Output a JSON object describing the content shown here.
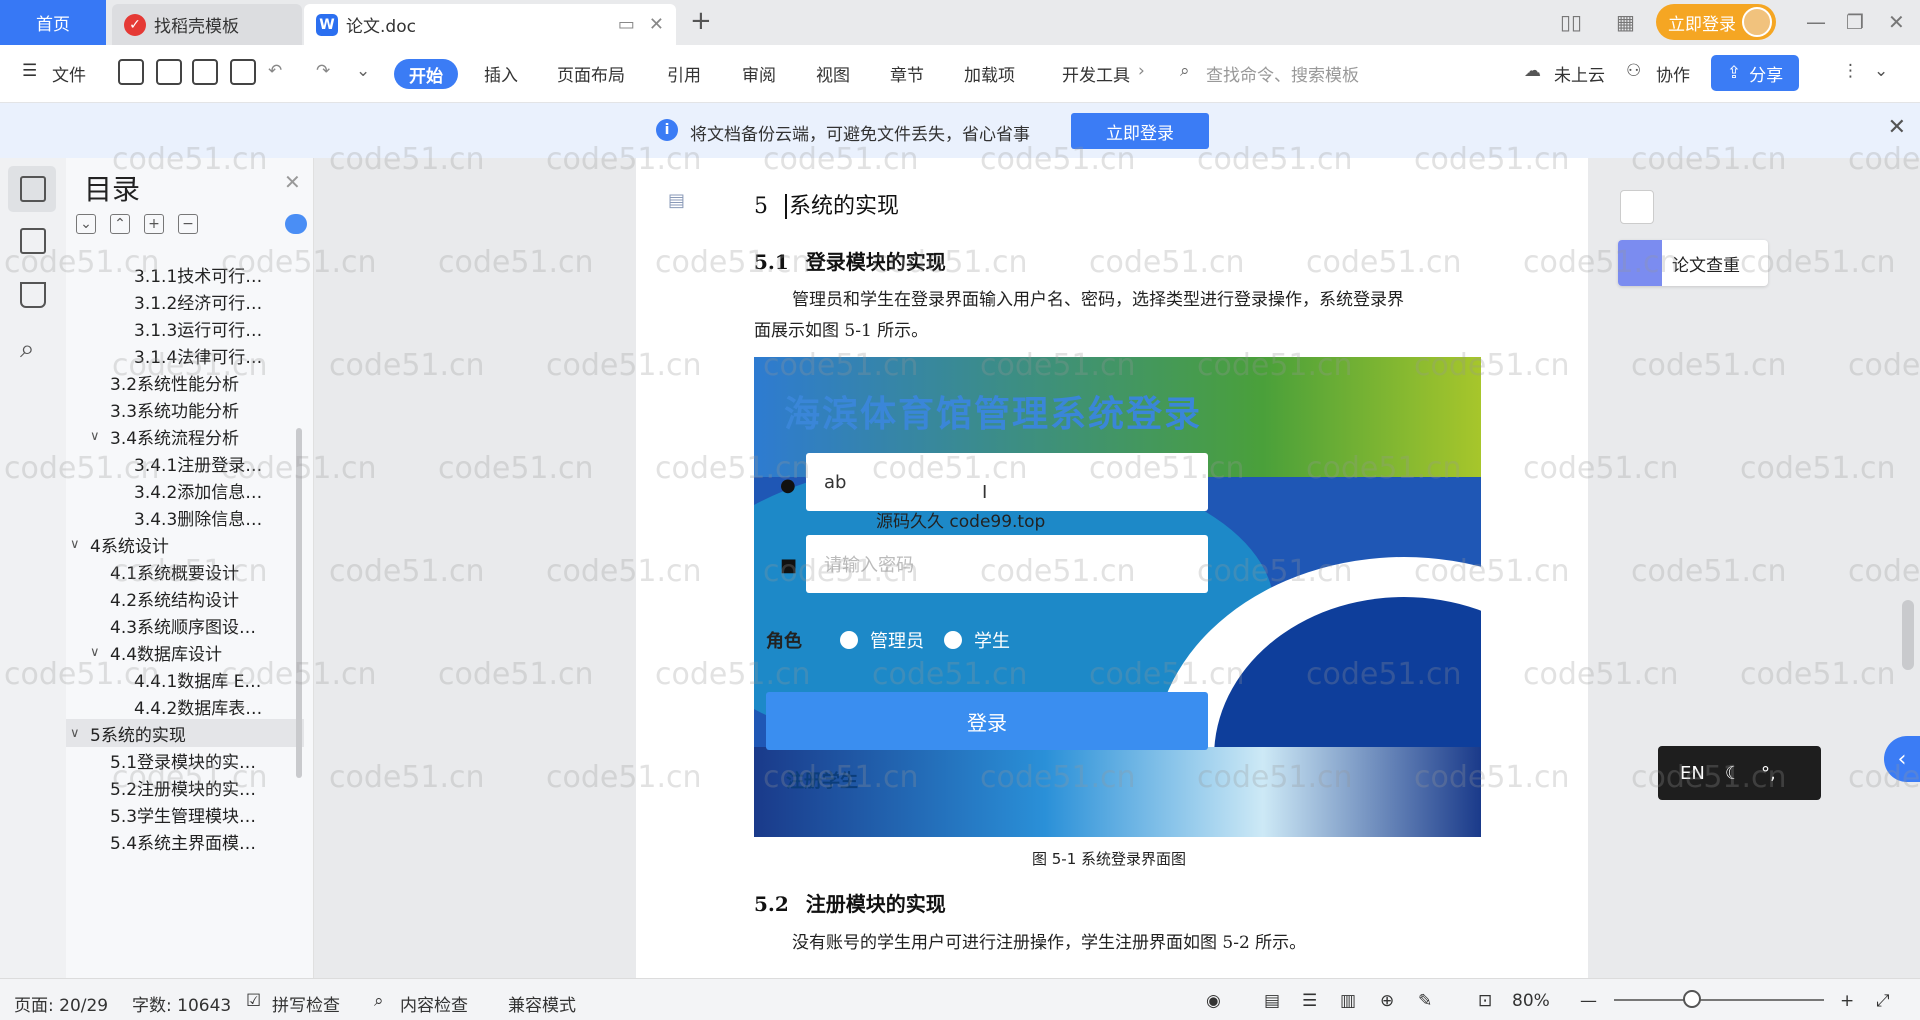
{
  "tabs": {
    "home": "首页",
    "template": "找稻壳模板",
    "doc": "论文.doc",
    "login": "立即登录"
  },
  "toolbar": {
    "file": "文件",
    "start": "开始",
    "items": [
      "插入",
      "页面布局",
      "引用",
      "审阅",
      "视图",
      "章节",
      "加载项",
      "开发工具"
    ],
    "search_placeholder": "查找命令、搜索模板",
    "cloud": "未上云",
    "collab": "协作",
    "share": "分享"
  },
  "notify": {
    "text": "将文档备份云端，可避免文件丢失，省心省事",
    "button": "立即登录"
  },
  "toc": {
    "title": "目录",
    "items": [
      {
        "label": "3.1.1技术可行…",
        "level": 3
      },
      {
        "label": "3.1.2经济可行…",
        "level": 3
      },
      {
        "label": "3.1.3运行可行…",
        "level": 3
      },
      {
        "label": "3.1.4法律可行…",
        "level": 3
      },
      {
        "label": "3.2系统性能分析",
        "level": 2
      },
      {
        "label": "3.3系统功能分析",
        "level": 2
      },
      {
        "label": "3.4系统流程分析",
        "level": 2,
        "expanded": true
      },
      {
        "label": "3.4.1注册登录…",
        "level": 3
      },
      {
        "label": "3.4.2添加信息…",
        "level": 3
      },
      {
        "label": "3.4.3删除信息…",
        "level": 3
      },
      {
        "label": "4系统设计",
        "level": 1,
        "expanded": true
      },
      {
        "label": "4.1系统概要设计",
        "level": 2
      },
      {
        "label": "4.2系统结构设计",
        "level": 2
      },
      {
        "label": "4.3系统顺序图设…",
        "level": 2
      },
      {
        "label": "4.4数据库设计",
        "level": 2,
        "expanded": true
      },
      {
        "label": "4.4.1数据库 E…",
        "level": 3
      },
      {
        "label": "4.4.2数据库表…",
        "level": 3
      },
      {
        "label": "5系统的实现",
        "level": 1,
        "expanded": true,
        "active": true
      },
      {
        "label": "5.1登录模块的实…",
        "level": 2
      },
      {
        "label": "5.2注册模块的实…",
        "level": 2
      },
      {
        "label": "5.3学生管理模块…",
        "level": 2
      },
      {
        "label": "5.4系统主界面模…",
        "level": 2
      }
    ]
  },
  "document": {
    "h1_num": "5",
    "h1": "系统的实现",
    "h2_1_num": "5.1",
    "h2_1": "登录模块的实现",
    "para1_line1": "管理员和学生在登录界面输入用户名、密码，选择类型进行登录操作，系统登录界",
    "para1_line2": "面展示如图 5-1 所示。",
    "figure": {
      "title": "海滨体育馆管理系统登录",
      "username_value": "ab",
      "watermark": "源码久久 code99.top",
      "password_placeholder": "请输入密码",
      "role_label": "角色",
      "role_admin": "管理员",
      "role_student": "学生",
      "login_button": "登录",
      "register_link": "注册学生"
    },
    "caption": "图 5-1 系统登录界面图",
    "h2_2_num": "5.2",
    "h2_2": "注册模块的实现",
    "para2": "没有账号的学生用户可进行注册操作，学生注册界面如图 5-2 所示。"
  },
  "right": {
    "check": "论文查重",
    "ime": "EN"
  },
  "status": {
    "page": "页面: 20/29",
    "words": "字数: 10643",
    "spell": "拼写检查",
    "content": "内容检查",
    "compat": "兼容模式",
    "zoom": "80%"
  },
  "watermark": "code51.cn"
}
